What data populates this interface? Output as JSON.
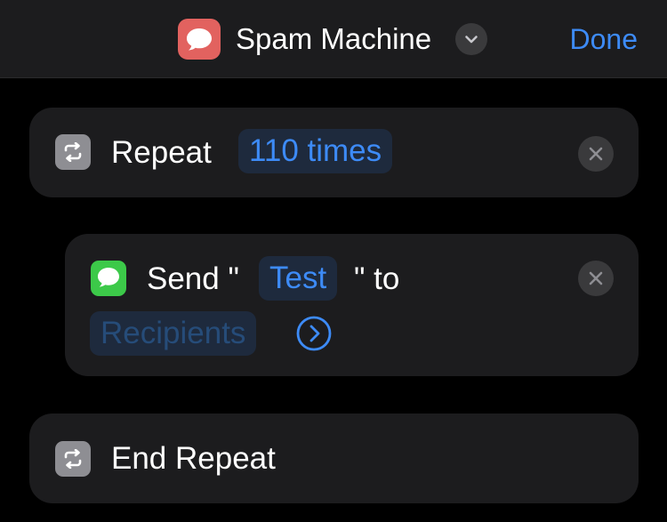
{
  "header": {
    "app_icon": "messages-bubble-icon",
    "title": "Spam Machine",
    "title_menu_icon": "chevron-down-icon",
    "done_label": "Done",
    "accent_color": "#3d8bf7"
  },
  "actions": [
    {
      "type": "repeat",
      "icon": "repeat-icon",
      "label": "Repeat",
      "count_token": "110 times",
      "remove_icon": "close-icon"
    },
    {
      "type": "send-message",
      "icon": "messages-icon",
      "label_prefix": "Send \"",
      "message_token": "Test",
      "label_suffix": "\" to",
      "recipients_placeholder": "Recipients",
      "expand_icon": "chevron-right-circle-icon",
      "remove_icon": "close-icon"
    },
    {
      "type": "end-repeat",
      "icon": "repeat-icon",
      "label": "End Repeat"
    }
  ]
}
